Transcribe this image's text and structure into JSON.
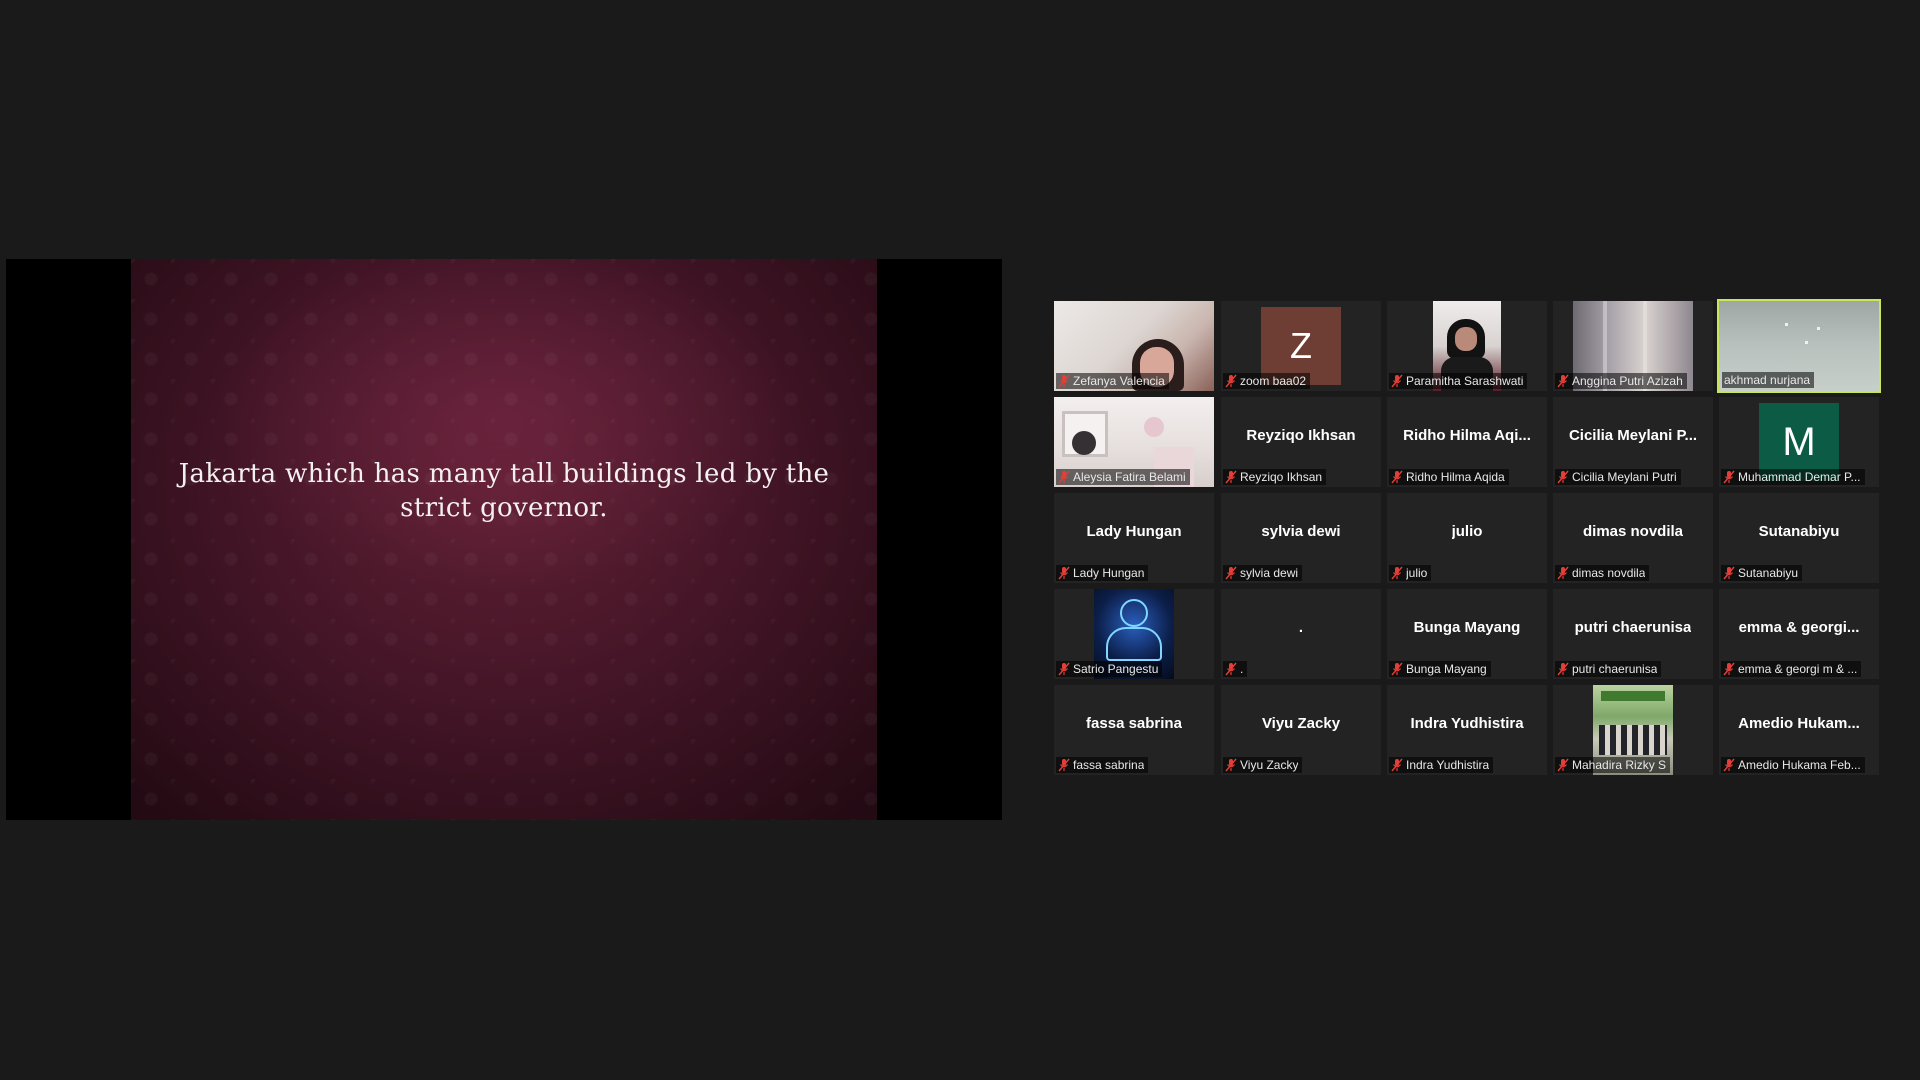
{
  "shared_screen": {
    "slide_text": "Jakarta which has many tall buildings led by the strict governor."
  },
  "colors": {
    "active_speaker_border": "#c9e65a",
    "muted_icon": "#e0403a",
    "avatar_z": "#6e3e34",
    "avatar_m": "#0b5b45"
  },
  "participants": [
    {
      "display_name": "Zefanya Valencia",
      "center_text": "",
      "tile": "video",
      "muted": true
    },
    {
      "display_name": "zoom baa02",
      "center_text": "Z",
      "tile": "avatar",
      "muted": true
    },
    {
      "display_name": "Paramitha Sarashwati",
      "center_text": "",
      "tile": "video",
      "muted": true
    },
    {
      "display_name": "Anggina Putri Azizah",
      "center_text": "",
      "tile": "video",
      "muted": true
    },
    {
      "display_name": "akhmad nurjana",
      "center_text": "",
      "tile": "video",
      "muted": false,
      "active": true
    },
    {
      "display_name": "Aleysia Fatira Belami",
      "center_text": "",
      "tile": "video",
      "muted": true
    },
    {
      "display_name": "Reyziqo Ikhsan",
      "center_text": "Reyziqo Ikhsan",
      "tile": "name",
      "muted": true
    },
    {
      "display_name": "Ridho Hilma Aqida",
      "center_text": "Ridho Hilma Aqi...",
      "tile": "name",
      "muted": true
    },
    {
      "display_name": "Cicilia Meylani Putri",
      "center_text": "Cicilia Meylani P...",
      "tile": "name",
      "muted": true
    },
    {
      "display_name": "Muhammad Demar P...",
      "center_text": "M",
      "tile": "avatar",
      "muted": true
    },
    {
      "display_name": "Lady Hungan",
      "center_text": "Lady Hungan",
      "tile": "name",
      "muted": true
    },
    {
      "display_name": "sylvia dewi",
      "center_text": "sylvia dewi",
      "tile": "name",
      "muted": true
    },
    {
      "display_name": "julio",
      "center_text": "julio",
      "tile": "name",
      "muted": true
    },
    {
      "display_name": "dimas novdila",
      "center_text": "dimas novdila",
      "tile": "name",
      "muted": true
    },
    {
      "display_name": "Sutanabiyu",
      "center_text": "Sutanabiyu",
      "tile": "name",
      "muted": true
    },
    {
      "display_name": "Satrio Pangestu",
      "center_text": "",
      "tile": "video",
      "muted": true
    },
    {
      "display_name": ".",
      "center_text": ".",
      "tile": "name",
      "muted": true
    },
    {
      "display_name": "Bunga Mayang",
      "center_text": "Bunga Mayang",
      "tile": "name",
      "muted": true
    },
    {
      "display_name": "putri chaerunisa",
      "center_text": "putri chaerunisa",
      "tile": "name",
      "muted": true
    },
    {
      "display_name": "emma & georgi m & ...",
      "center_text": "emma & georgi...",
      "tile": "name",
      "muted": true
    },
    {
      "display_name": "fassa sabrina",
      "center_text": "fassa sabrina",
      "tile": "name",
      "muted": true
    },
    {
      "display_name": "Viyu Zacky",
      "center_text": "Viyu Zacky",
      "tile": "name",
      "muted": true
    },
    {
      "display_name": "Indra Yudhistira",
      "center_text": "Indra Yudhistira",
      "tile": "name",
      "muted": true
    },
    {
      "display_name": "Mahadira Rizky S",
      "center_text": "",
      "tile": "video",
      "muted": true
    },
    {
      "display_name": "Amedio Hukama Feb...",
      "center_text": "Amedio Hukam...",
      "tile": "name",
      "muted": true
    }
  ]
}
